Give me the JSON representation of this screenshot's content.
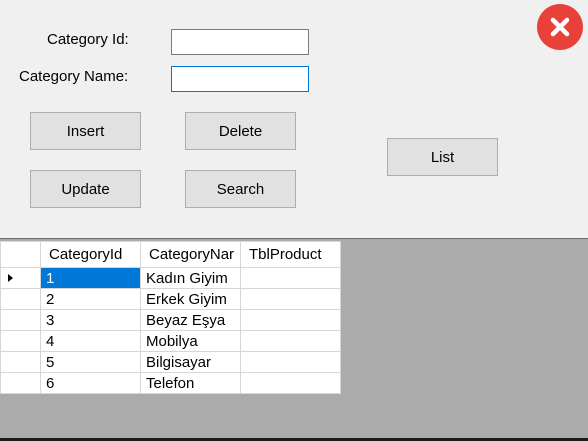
{
  "form": {
    "category_id_label": "Category Id:",
    "category_name_label": "Category Name:",
    "category_id_value": "",
    "category_name_value": ""
  },
  "buttons": {
    "insert": "Insert",
    "delete": "Delete",
    "update": "Update",
    "search": "Search",
    "list": "List"
  },
  "close_icon": "close-x-icon",
  "colors": {
    "close_red": "#e8413a",
    "selection_blue": "#0078d7",
    "grid_background": "#ababab"
  },
  "grid": {
    "columns": [
      "CategoryId",
      "CategoryNar",
      "TblProduct"
    ],
    "rows": [
      {
        "id": "1",
        "name": "Kadın Giyim",
        "product": ""
      },
      {
        "id": "2",
        "name": "Erkek Giyim",
        "product": ""
      },
      {
        "id": "3",
        "name": "Beyaz Eşya",
        "product": ""
      },
      {
        "id": "4",
        "name": "Mobilya",
        "product": ""
      },
      {
        "id": "5",
        "name": "Bilgisayar",
        "product": ""
      },
      {
        "id": "6",
        "name": "Telefon",
        "product": ""
      }
    ]
  }
}
